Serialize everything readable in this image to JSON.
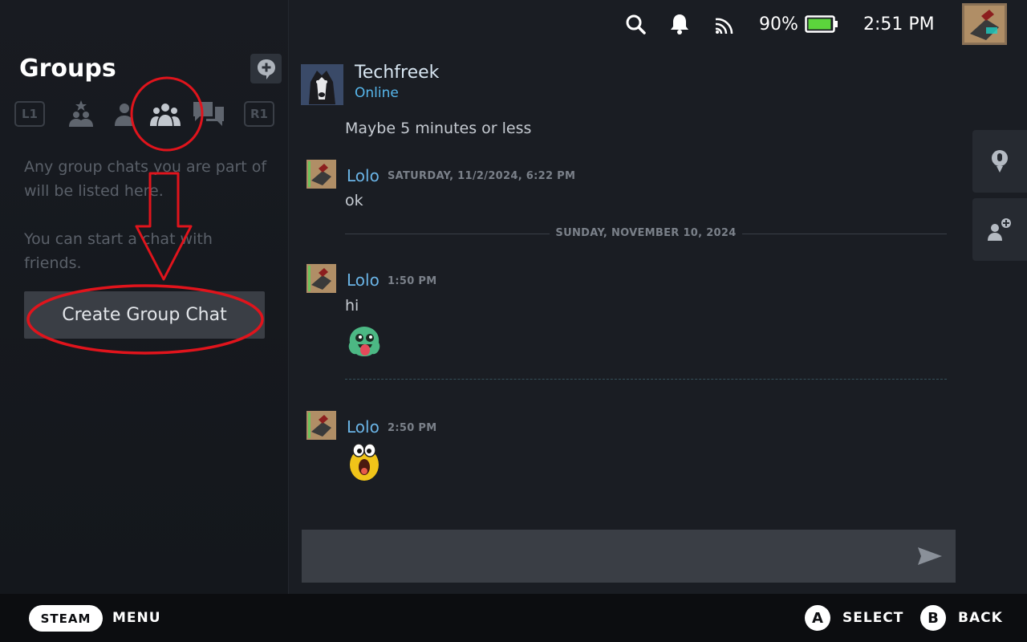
{
  "sidebar": {
    "title": "Groups",
    "tabs": {
      "left_bumper": "L1",
      "right_bumper": "R1"
    },
    "empty_text_1": "Any group chats you are part of will be listed here.",
    "empty_text_2": "You can start a chat with friends.",
    "create_button": "Create Group Chat"
  },
  "status_bar": {
    "battery_percent": "90%",
    "battery_level": 0.9,
    "time": "2:51 PM"
  },
  "chat": {
    "friend_name": "Techfreek",
    "friend_status": "Online",
    "messages": [
      {
        "text": "Maybe 5 minutes or less"
      },
      {
        "author": "Lolo",
        "time": "SATURDAY, 11/2/2024, 6:22 PM",
        "text": "ok"
      },
      {
        "author": "Lolo",
        "time": "1:50 PM",
        "text": "hi",
        "sticker": "green-monster-emoticon"
      },
      {
        "author": "Lolo",
        "time": "2:50 PM",
        "sticker": "yellow-screaming-emoticon"
      }
    ],
    "date_divider": "SUNDAY, NOVEMBER 10, 2024",
    "input_value": ""
  },
  "footer": {
    "steam_label": "STEAM",
    "menu_label": "MENU",
    "select_button": "A",
    "select_label": "SELECT",
    "back_button": "B",
    "back_label": "BACK"
  },
  "colors": {
    "accent_name": "#6ab4e6",
    "online": "#57b7ec",
    "annotation": "#e0141c",
    "battery": "#5cd43c"
  }
}
